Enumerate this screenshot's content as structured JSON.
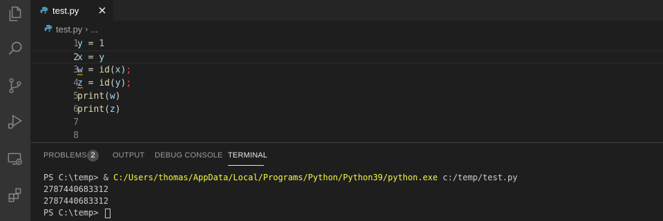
{
  "tab": {
    "filename": "test.py"
  },
  "breadcrumb": {
    "file": "test.py",
    "separator": "›",
    "ellipsis": "..."
  },
  "editor": {
    "active_line": 2,
    "lines": [
      {
        "num": "1",
        "tokens": [
          [
            "var",
            "y"
          ],
          [
            "op",
            " = "
          ],
          [
            "num",
            "1"
          ]
        ]
      },
      {
        "num": "2",
        "tokens": [
          [
            "var",
            "x"
          ],
          [
            "op",
            " = "
          ],
          [
            "var",
            "y"
          ]
        ]
      },
      {
        "num": "3",
        "tokens": [
          [
            "var",
            "w"
          ],
          [
            "op",
            " = "
          ],
          [
            "fn",
            "id"
          ],
          [
            "op",
            "("
          ],
          [
            "var",
            "x"
          ],
          [
            "op",
            ")"
          ],
          [
            "semi",
            ";"
          ]
        ],
        "squiggle_first": true
      },
      {
        "num": "4",
        "tokens": [
          [
            "var",
            "z"
          ],
          [
            "op",
            " = "
          ],
          [
            "fn",
            "id"
          ],
          [
            "op",
            "("
          ],
          [
            "var",
            "y"
          ],
          [
            "op",
            ")"
          ],
          [
            "semi",
            ";"
          ]
        ],
        "squiggle_first": true
      },
      {
        "num": "5",
        "tokens": [
          [
            "fn",
            "print"
          ],
          [
            "op",
            "("
          ],
          [
            "var",
            "w"
          ],
          [
            "op",
            ")"
          ]
        ]
      },
      {
        "num": "6",
        "tokens": [
          [
            "fn",
            "print"
          ],
          [
            "op",
            "("
          ],
          [
            "var",
            "z"
          ],
          [
            "op",
            ")"
          ]
        ]
      },
      {
        "num": "7",
        "tokens": []
      },
      {
        "num": "8",
        "tokens": []
      }
    ]
  },
  "panel": {
    "tabs": [
      "PROBLEMS",
      "OUTPUT",
      "DEBUG CONSOLE",
      "TERMINAL"
    ],
    "problems_count": "2",
    "active_tab": "TERMINAL"
  },
  "terminal": {
    "prompt": "PS C:\\temp> ",
    "command_prefix": "& ",
    "command_path": "C:/Users/thomas/AppData/Local/Programs/Python/Python39/python.exe",
    "command_arg": " c:/temp/test.py",
    "output_1": "2787440683312",
    "output_2": "2787440683312",
    "final_prompt": "PS C:\\temp> "
  },
  "colors": {
    "activity_bar": "#333333",
    "editor_bg": "#1e1e1e",
    "python_blue": "#519aba",
    "error_red": "#f14c4c",
    "warning_squiggle": "#cca700"
  },
  "icons": [
    "files-icon",
    "search-icon",
    "source-control-icon",
    "run-debug-icon",
    "remote-explorer-icon",
    "extensions-icon",
    "python-file-icon",
    "close-icon",
    "chevron-right-icon"
  ]
}
